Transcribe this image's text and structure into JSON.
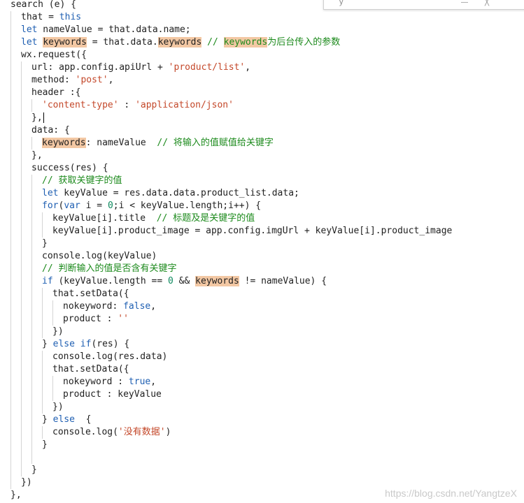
{
  "popup": {
    "text": "y",
    "icons": [
      "minimize-icon",
      "close-icon"
    ]
  },
  "watermark": "https://blog.csdn.net/YangtzeX",
  "code": {
    "lines": [
      {
        "indent": 0,
        "tokens": [
          {
            "t": "search (e) {",
            "c": "plain"
          }
        ]
      },
      {
        "indent": 1,
        "tokens": [
          {
            "t": "that = ",
            "c": "plain"
          },
          {
            "t": "this",
            "c": "kw"
          }
        ]
      },
      {
        "indent": 1,
        "tokens": [
          {
            "t": "let",
            "c": "kw"
          },
          {
            "t": " nameValue = that.data.name;",
            "c": "plain"
          }
        ]
      },
      {
        "indent": 1,
        "tokens": [
          {
            "t": "let",
            "c": "kw"
          },
          {
            "t": " ",
            "c": "plain"
          },
          {
            "t": "keywords",
            "c": "hl"
          },
          {
            "t": " = that.data.",
            "c": "plain"
          },
          {
            "t": "keywords",
            "c": "hl"
          },
          {
            "t": " // ",
            "c": "cmt"
          },
          {
            "t": "keywords",
            "c": "cmthl"
          },
          {
            "t": "为后台传入的参数",
            "c": "cmt"
          }
        ]
      },
      {
        "indent": 1,
        "tokens": [
          {
            "t": "wx.request({",
            "c": "plain"
          }
        ]
      },
      {
        "indent": 2,
        "tokens": [
          {
            "t": "url: app.config.apiUrl + ",
            "c": "plain"
          },
          {
            "t": "'product/list'",
            "c": "str"
          },
          {
            "t": ",",
            "c": "plain"
          }
        ]
      },
      {
        "indent": 2,
        "tokens": [
          {
            "t": "method: ",
            "c": "plain"
          },
          {
            "t": "'post'",
            "c": "str"
          },
          {
            "t": ",",
            "c": "plain"
          }
        ]
      },
      {
        "indent": 2,
        "tokens": [
          {
            "t": "header :{",
            "c": "plain"
          }
        ]
      },
      {
        "indent": 3,
        "tokens": [
          {
            "t": "'content-type'",
            "c": "str"
          },
          {
            "t": " : ",
            "c": "plain"
          },
          {
            "t": "'application/json'",
            "c": "str"
          }
        ]
      },
      {
        "indent": 2,
        "tokens": [
          {
            "t": "},",
            "c": "plain"
          }
        ],
        "cursor": true
      },
      {
        "indent": 2,
        "tokens": [
          {
            "t": "data: {",
            "c": "plain"
          }
        ]
      },
      {
        "indent": 3,
        "tokens": [
          {
            "t": "keywords",
            "c": "hl"
          },
          {
            "t": ": nameValue  ",
            "c": "plain"
          },
          {
            "t": "// 将输入的值赋值给关键字",
            "c": "cmt"
          }
        ]
      },
      {
        "indent": 2,
        "tokens": [
          {
            "t": "},",
            "c": "plain"
          }
        ]
      },
      {
        "indent": 2,
        "tokens": [
          {
            "t": "success(res) {",
            "c": "plain"
          }
        ]
      },
      {
        "indent": 3,
        "tokens": [
          {
            "t": "// 获取关键字的值",
            "c": "cmt"
          }
        ]
      },
      {
        "indent": 3,
        "tokens": [
          {
            "t": "let",
            "c": "kw"
          },
          {
            "t": " keyValue = res.data.data.product_list.data;",
            "c": "plain"
          }
        ]
      },
      {
        "indent": 3,
        "tokens": [
          {
            "t": "for",
            "c": "kw"
          },
          {
            "t": "(",
            "c": "plain"
          },
          {
            "t": "var",
            "c": "kw"
          },
          {
            "t": " i = ",
            "c": "plain"
          },
          {
            "t": "0",
            "c": "num"
          },
          {
            "t": ";i < keyValue.length;i++) {",
            "c": "plain"
          }
        ]
      },
      {
        "indent": 4,
        "tokens": [
          {
            "t": "keyValue[i].title  ",
            "c": "plain"
          },
          {
            "t": "// 标题及是关键字的值",
            "c": "cmt"
          }
        ]
      },
      {
        "indent": 4,
        "tokens": [
          {
            "t": "keyValue[i].product_image = app.config.imgUrl + keyValue[i].product_image",
            "c": "plain"
          }
        ]
      },
      {
        "indent": 3,
        "tokens": [
          {
            "t": "}",
            "c": "plain"
          }
        ]
      },
      {
        "indent": 3,
        "tokens": [
          {
            "t": "console.log(keyValue)",
            "c": "plain"
          }
        ]
      },
      {
        "indent": 3,
        "tokens": [
          {
            "t": "// 判断输入的值是否含有关键字",
            "c": "cmt"
          }
        ]
      },
      {
        "indent": 3,
        "tokens": [
          {
            "t": "if",
            "c": "kw"
          },
          {
            "t": " (keyValue.length == ",
            "c": "plain"
          },
          {
            "t": "0",
            "c": "num"
          },
          {
            "t": " && ",
            "c": "plain"
          },
          {
            "t": "keywords",
            "c": "hl"
          },
          {
            "t": " != nameValue) {",
            "c": "plain"
          }
        ]
      },
      {
        "indent": 4,
        "tokens": [
          {
            "t": "that.setData({",
            "c": "plain"
          }
        ]
      },
      {
        "indent": 5,
        "tokens": [
          {
            "t": "nokeyword: ",
            "c": "plain"
          },
          {
            "t": "false",
            "c": "kw"
          },
          {
            "t": ",",
            "c": "plain"
          }
        ]
      },
      {
        "indent": 5,
        "tokens": [
          {
            "t": "product : ",
            "c": "plain"
          },
          {
            "t": "''",
            "c": "str"
          }
        ]
      },
      {
        "indent": 4,
        "tokens": [
          {
            "t": "})",
            "c": "plain"
          }
        ]
      },
      {
        "indent": 3,
        "tokens": [
          {
            "t": "} ",
            "c": "plain"
          },
          {
            "t": "else if",
            "c": "kw"
          },
          {
            "t": "(res) {",
            "c": "plain"
          }
        ]
      },
      {
        "indent": 4,
        "tokens": [
          {
            "t": "console.log(res.data)",
            "c": "plain"
          }
        ]
      },
      {
        "indent": 4,
        "tokens": [
          {
            "t": "that.setData({",
            "c": "plain"
          }
        ]
      },
      {
        "indent": 5,
        "tokens": [
          {
            "t": "nokeyword : ",
            "c": "plain"
          },
          {
            "t": "true",
            "c": "kw"
          },
          {
            "t": ",",
            "c": "plain"
          }
        ]
      },
      {
        "indent": 5,
        "tokens": [
          {
            "t": "product : keyValue",
            "c": "plain"
          }
        ]
      },
      {
        "indent": 4,
        "tokens": [
          {
            "t": "})",
            "c": "plain"
          }
        ]
      },
      {
        "indent": 3,
        "tokens": [
          {
            "t": "} ",
            "c": "plain"
          },
          {
            "t": "else",
            "c": "kw"
          },
          {
            "t": "  {",
            "c": "plain"
          }
        ]
      },
      {
        "indent": 4,
        "tokens": [
          {
            "t": "console.log(",
            "c": "plain"
          },
          {
            "t": "'没有数据'",
            "c": "str"
          },
          {
            "t": ")",
            "c": "plain"
          }
        ]
      },
      {
        "indent": 3,
        "tokens": [
          {
            "t": "}",
            "c": "plain"
          }
        ]
      },
      {
        "indent": 3,
        "tokens": []
      },
      {
        "indent": 2,
        "tokens": [
          {
            "t": "}",
            "c": "plain"
          }
        ]
      },
      {
        "indent": 1,
        "tokens": [
          {
            "t": "})",
            "c": "plain"
          }
        ]
      },
      {
        "indent": 0,
        "tokens": [
          {
            "t": "},",
            "c": "plain"
          }
        ]
      }
    ]
  }
}
